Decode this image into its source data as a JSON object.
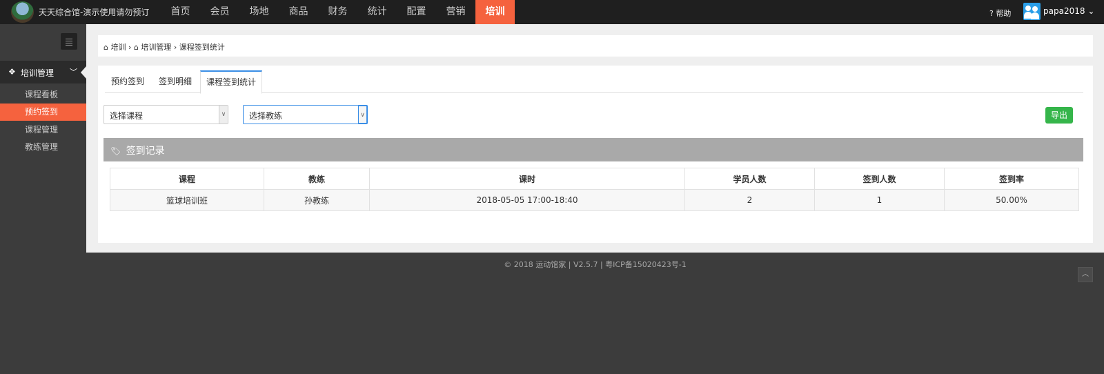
{
  "header": {
    "brand": "天天综合馆-演示使用请勿预订",
    "nav": [
      "首页",
      "会员",
      "场地",
      "商品",
      "财务",
      "统计",
      "配置",
      "营销",
      "培训"
    ],
    "help": "帮助",
    "username": "papa2018"
  },
  "sidebar": {
    "group_label": "培训管理",
    "items": [
      {
        "label": "课程看板"
      },
      {
        "label": "预约签到"
      },
      {
        "label": "课程管理"
      },
      {
        "label": "教练管理"
      }
    ]
  },
  "breadcrumb": {
    "root": "培训",
    "level2": "培训管理",
    "current": "课程签到统计"
  },
  "tabs": [
    "预约签到",
    "签到明细",
    "课程签到统计"
  ],
  "filters": {
    "course_placeholder": "选择课程",
    "coach_placeholder": "选择教练"
  },
  "export_label": "导出",
  "section_title": "签到记录",
  "table": {
    "headers": [
      "课程",
      "教练",
      "课时",
      "学员人数",
      "签到人数",
      "签到率"
    ],
    "rows": [
      [
        "篮球培训班",
        "孙教练",
        "2018-05-05 17:00-18:40",
        "2",
        "1",
        "50.00%"
      ]
    ]
  },
  "footer": "© 2018 运动馆家 | V2.5.7 | 粤ICP备15020423号-1"
}
